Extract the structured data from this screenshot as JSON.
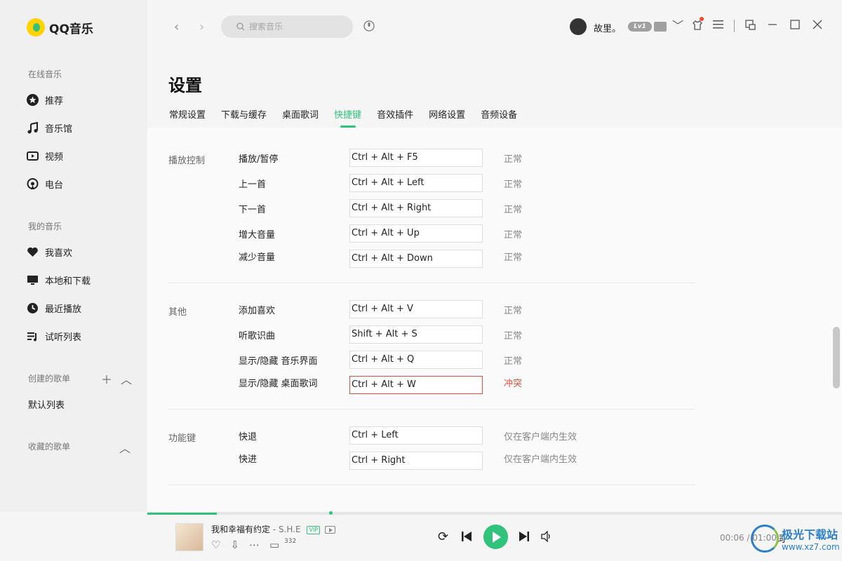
{
  "app": {
    "logo_text": "QQ音乐"
  },
  "sidebar": {
    "section_online": "在线音乐",
    "online_items": [
      {
        "label": "推荐",
        "icon": "star-icon"
      },
      {
        "label": "音乐馆",
        "icon": "music-note-icon"
      },
      {
        "label": "视频",
        "icon": "video-icon"
      },
      {
        "label": "电台",
        "icon": "radio-icon"
      }
    ],
    "section_mine": "我的音乐",
    "mine_items": [
      {
        "label": "我喜欢",
        "icon": "heart-icon"
      },
      {
        "label": "本地和下载",
        "icon": "monitor-icon"
      },
      {
        "label": "最近播放",
        "icon": "clock-icon"
      },
      {
        "label": "试听列表",
        "icon": "playlist-icon"
      }
    ],
    "section_created": "创建的歌单",
    "created_items": [
      "默认列表"
    ],
    "section_collected": "收藏的歌单"
  },
  "topbar": {
    "search_placeholder": "搜索音乐",
    "username": "故里。",
    "level_badge": "Lv1"
  },
  "settings": {
    "title": "设置",
    "tabs": [
      "常规设置",
      "下载与缓存",
      "桌面歌词",
      "快捷键",
      "音效插件",
      "网络设置",
      "音频设备"
    ],
    "active_tab": "快捷键",
    "groups": [
      {
        "label": "播放控制",
        "rows": [
          {
            "label": "播放/暂停",
            "shortcut": "Ctrl + Alt + F5",
            "status": "正常"
          },
          {
            "label": "上一首",
            "shortcut": "Ctrl + Alt + Left",
            "status": "正常"
          },
          {
            "label": "下一首",
            "shortcut": "Ctrl + Alt + Right",
            "status": "正常"
          },
          {
            "label": "增大音量",
            "shortcut": "Ctrl + Alt + Up",
            "status": "正常"
          },
          {
            "label": "减少音量",
            "shortcut": "Ctrl + Alt + Down",
            "status": "正常"
          }
        ]
      },
      {
        "label": "其他",
        "rows": [
          {
            "label": "添加喜欢",
            "shortcut": "Ctrl + Alt + V",
            "status": "正常"
          },
          {
            "label": "听歌识曲",
            "shortcut": "Shift + Alt + S",
            "status": "正常"
          },
          {
            "label": "显示/隐藏 音乐界面",
            "shortcut": "Ctrl + Alt + Q",
            "status": "正常"
          },
          {
            "label": "显示/隐藏 桌面歌词",
            "shortcut": "Ctrl + Alt + W",
            "status": "冲突",
            "conflict": true
          }
        ]
      },
      {
        "label": "功能键",
        "rows": [
          {
            "label": "快退",
            "shortcut": "Ctrl + Left",
            "status": "仅在客户端内生效"
          },
          {
            "label": "快进",
            "shortcut": "Ctrl + Right",
            "status": "仅在客户端内生效"
          }
        ]
      }
    ]
  },
  "player": {
    "song_title": "我和幸福有约定",
    "song_artist": "S.H.E",
    "vip_tag": "VIP",
    "comment_count": "332",
    "time": "00:06 / 01:00",
    "lyric_label": "词",
    "progress_fraction": 0.1
  },
  "watermark": {
    "top": "极光下载站",
    "bottom": "www.xz7.com"
  },
  "colors": {
    "accent": "#31c27c",
    "conflict": "#e74c3c"
  }
}
